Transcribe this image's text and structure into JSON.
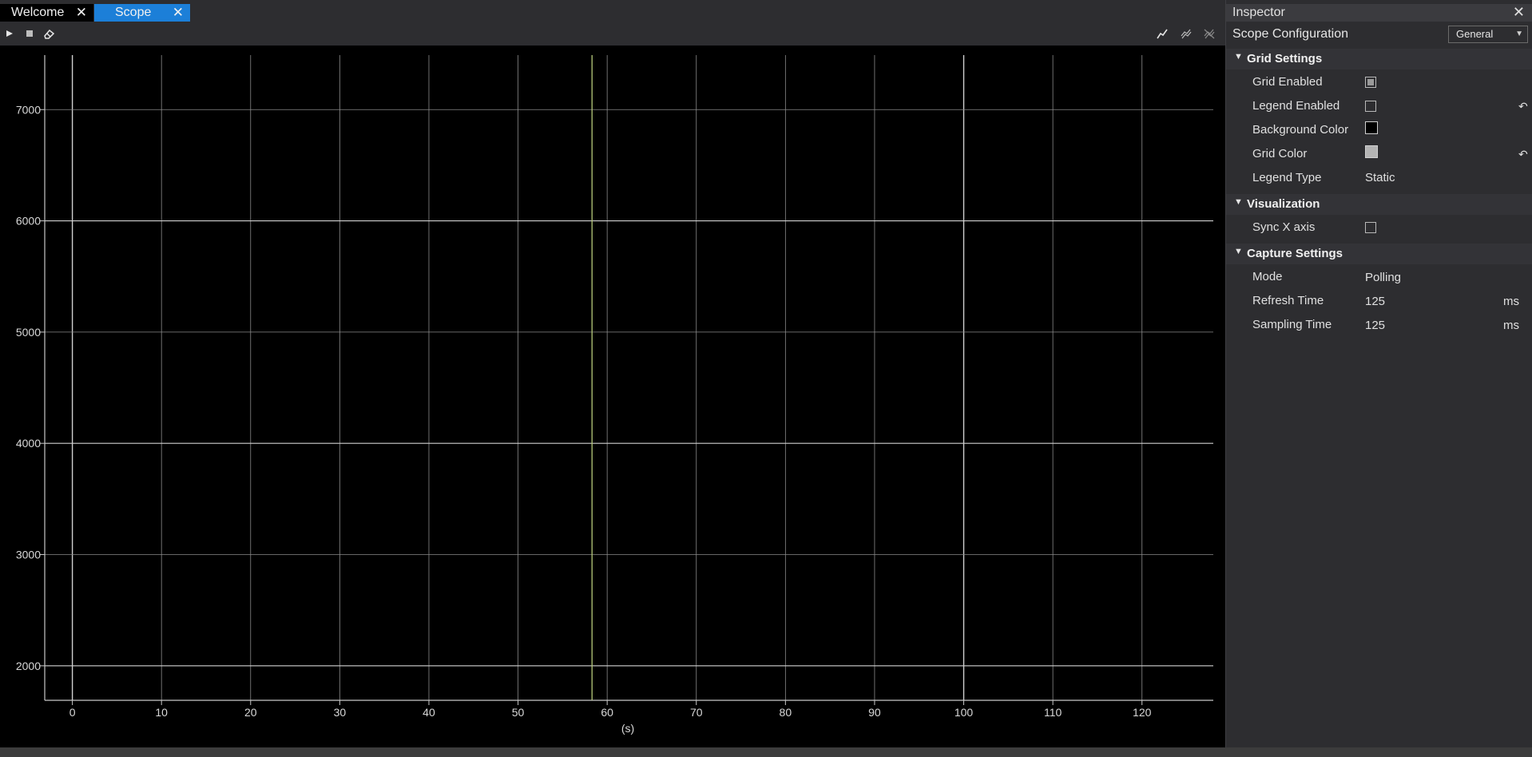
{
  "tabs": [
    {
      "label": "Welcome",
      "active": false
    },
    {
      "label": "Scope",
      "active": true
    }
  ],
  "toolbar": {
    "left_icons": [
      "play-icon",
      "stop-icon",
      "eraser-icon"
    ],
    "right_icons": [
      "line-chart-icon",
      "zoom-fit-icon",
      "zoom-reset-icon"
    ]
  },
  "chart_data": {
    "type": "line",
    "series": [],
    "x_ticks": [
      0,
      10,
      20,
      30,
      40,
      50,
      60,
      70,
      80,
      90,
      100,
      110,
      120
    ],
    "y_ticks": [
      2000,
      3000,
      4000,
      5000,
      6000,
      7000
    ],
    "xlim": [
      -3.1,
      128.0
    ],
    "ylim": [
      1690,
      7490
    ],
    "xlabel": "(s)",
    "ylabel": "",
    "grid": true,
    "cursor_x": 58.3,
    "colors": {
      "background": "#000000",
      "grid": "#8a8a8a",
      "grid_major": "#d0d0d0",
      "axis": "#c8c8c8",
      "cursor": "#b5c97a"
    }
  },
  "inspector": {
    "title": "Inspector",
    "config_label": "Scope Configuration",
    "config_value": "General",
    "sections": {
      "grid": {
        "title": "Grid Settings",
        "grid_enabled_label": "Grid Enabled",
        "grid_enabled": true,
        "legend_enabled_label": "Legend Enabled",
        "legend_enabled": false,
        "background_color_label": "Background Color",
        "background_color": "#000000",
        "grid_color_label": "Grid Color",
        "grid_color": "#b4b4b4",
        "legend_type_label": "Legend Type",
        "legend_type": "Static"
      },
      "visualization": {
        "title": "Visualization",
        "sync_x_label": "Sync X axis",
        "sync_x": false
      },
      "capture": {
        "title": "Capture Settings",
        "mode_label": "Mode",
        "mode": "Polling",
        "refresh_label": "Refresh Time",
        "refresh_value": "125",
        "refresh_unit": "ms",
        "sampling_label": "Sampling Time",
        "sampling_value": "125",
        "sampling_unit": "ms"
      }
    }
  },
  "colors": {
    "accent": "#1c7fd8",
    "panel": "#2d2d30"
  }
}
